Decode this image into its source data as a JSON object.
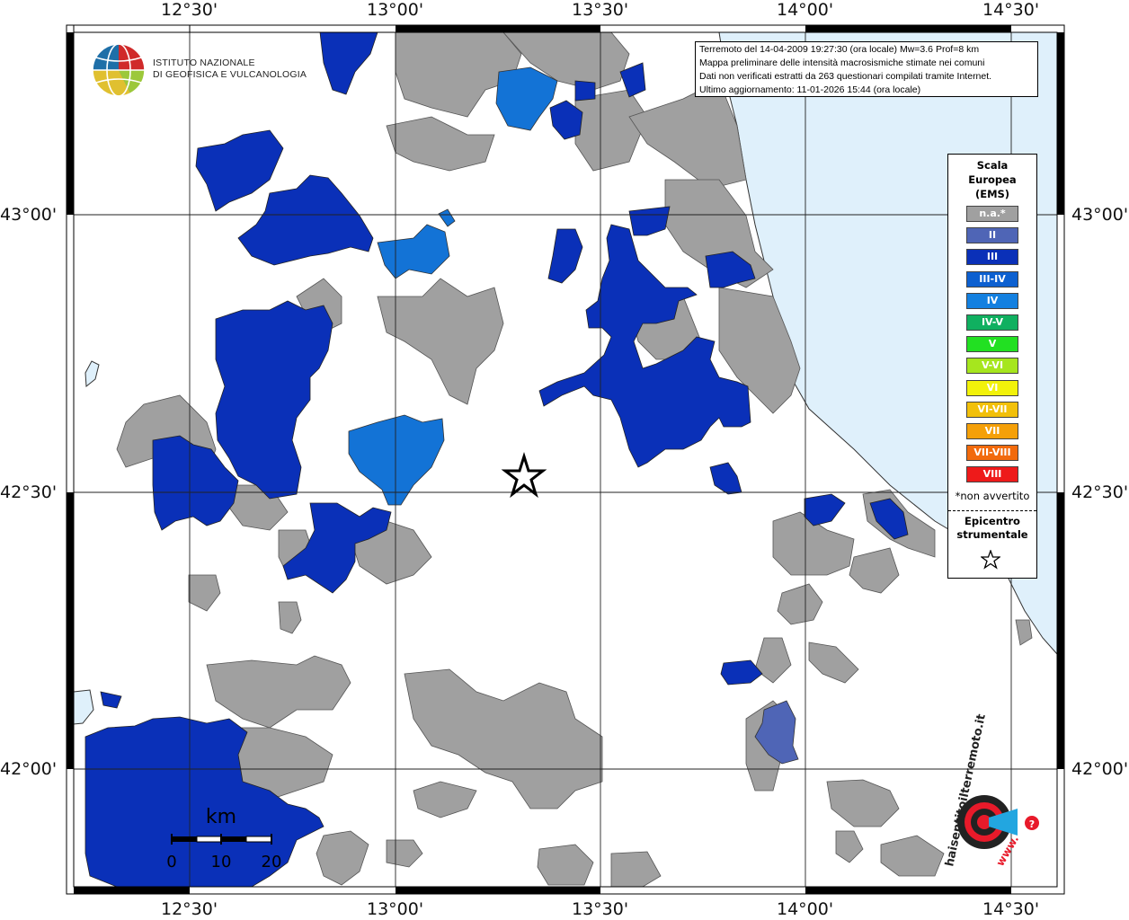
{
  "header": {
    "logo_line1": "ISTITUTO NAZIONALE",
    "logo_line2": "DI GEOFISICA E VULCANOLOGIA"
  },
  "info": {
    "line1": "Terremoto del 14-04-2009 19:27:30 (ora locale) Mw=3.6 Prof=8 km",
    "line2": "Mappa preliminare delle intensità macrosismiche stimate nei comuni",
    "line3": "Dati non verificati estratti da 263 questionari compilati tramite Internet.",
    "line4": "Ultimo aggiornamento: 11-01-2026 15:44 (ora locale)"
  },
  "axes": {
    "lon_labels": [
      "12°30'",
      "13°00'",
      "13°30'",
      "14°00'",
      "14°30'"
    ],
    "lat_labels": [
      "43°00'",
      "42°30'",
      "42°00'"
    ]
  },
  "legend": {
    "title_line1": "Scala",
    "title_line2": "Europea",
    "title_line3": "(EMS)",
    "items": [
      {
        "label": "n.a.*",
        "color": "#a0a0a0"
      },
      {
        "label": "II",
        "color": "#4f65b6"
      },
      {
        "label": "III",
        "color": "#0a30b8"
      },
      {
        "label": "III-IV",
        "color": "#0d60d0"
      },
      {
        "label": "IV",
        "color": "#1380e0"
      },
      {
        "label": "IV-V",
        "color": "#10b060"
      },
      {
        "label": "V",
        "color": "#22e022"
      },
      {
        "label": "V-VI",
        "color": "#a6e61e"
      },
      {
        "label": "VI",
        "color": "#f2f20a"
      },
      {
        "label": "VI-VII",
        "color": "#f2c00a"
      },
      {
        "label": "VII",
        "color": "#f5a008"
      },
      {
        "label": "VII-VIII",
        "color": "#f26a0c"
      },
      {
        "label": "VIII",
        "color": "#ee1a1a"
      }
    ],
    "note": "*non avvertito",
    "epicenter_line1": "Epicentro",
    "epicenter_line2": "strumentale"
  },
  "scale": {
    "unit": "km",
    "ticks": [
      "0",
      "10",
      "20"
    ]
  },
  "watermark": {
    "text": "haisentitoilterremoto.it",
    "url_text": "www."
  },
  "colors": {
    "sea": "#dff0fb",
    "na": "#a0a0a0",
    "ii": "#4f65b6",
    "iii": "#0a30b8",
    "iii_iv": "#0d60d0",
    "iv": "#1380e0"
  }
}
